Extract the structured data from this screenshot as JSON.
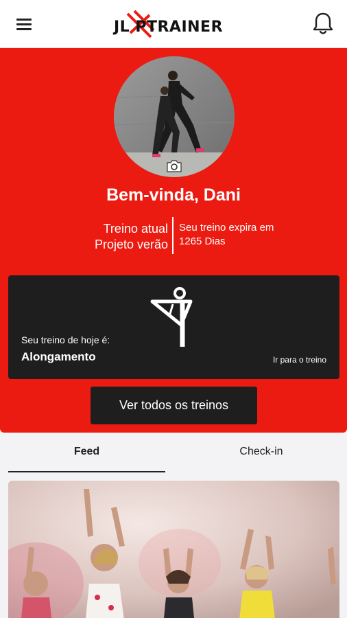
{
  "header": {
    "logo_text": "JL PTRAINER",
    "menu_icon": "hamburger-menu-icon",
    "bell_icon": "bell-icon"
  },
  "profile": {
    "welcome": "Bem-vinda, Dani",
    "camera_icon": "camera-icon",
    "current_training_label": "Treino atual",
    "current_training_name": "Projeto verão",
    "expiry_label": "Seu treino expira em",
    "expiry_value": "1265 Dias"
  },
  "today": {
    "label": "Seu treino de hoje é:",
    "name": "Alongamento",
    "link": "Ir para o treino",
    "icon": "stretching-icon"
  },
  "all_trainings_button": "Ver todos os treinos",
  "tabs": [
    {
      "label": "Feed",
      "active": true
    },
    {
      "label": "Check-in",
      "active": false
    }
  ],
  "colors": {
    "brand_red": "#ec1b12",
    "dark": "#1e1e1e",
    "background": "#f3f3f6"
  }
}
